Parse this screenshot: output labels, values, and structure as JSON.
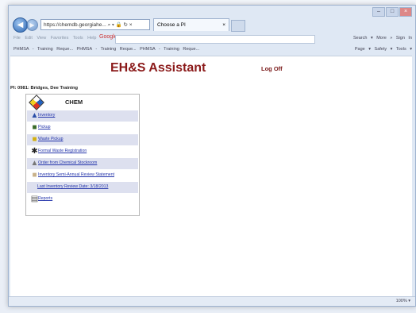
{
  "browser": {
    "address_text": "https://chemdb.georgiahe... ⌕ ▾ 🔒 ↻ ×",
    "tab_label": "Choose a PI",
    "menu_text": "File  Edit  View  Favorites  Tools  Help",
    "google_label": "Google",
    "menu_right_text": "Search ▾  More »       Sign In",
    "favorites_text": "PHMSA - Training Reque...   PHMSA - Training Reque...   PHMSA - Training Reque...",
    "tools_text": "Page ▾  Safety ▾  Tools ▾",
    "zoom_text": "100% ▾"
  },
  "page": {
    "title": "EH&S Assistant",
    "logoff": "Log Off",
    "pi_line": "PI: 0981: Bridges, Dee Training"
  },
  "panel": {
    "header": "CHEM",
    "items": [
      {
        "label": "Inventory",
        "icon": "flask-icon"
      },
      {
        "label": "Pickup",
        "icon": "truck-icon"
      },
      {
        "label": "Waste Pickup",
        "icon": "waste-truck-icon"
      },
      {
        "label": "Formal Waste Registration",
        "icon": "person-icon"
      },
      {
        "label": "Order from Chemical Stockroom",
        "icon": "stockroom-icon"
      },
      {
        "label": "Inventory Semi-Annual Review Statement",
        "icon": "document-icon"
      },
      {
        "label": "Last Inventory Review Date: 3/18/2013",
        "icon": ""
      },
      {
        "label": "Reports",
        "icon": "printer-icon"
      }
    ]
  }
}
